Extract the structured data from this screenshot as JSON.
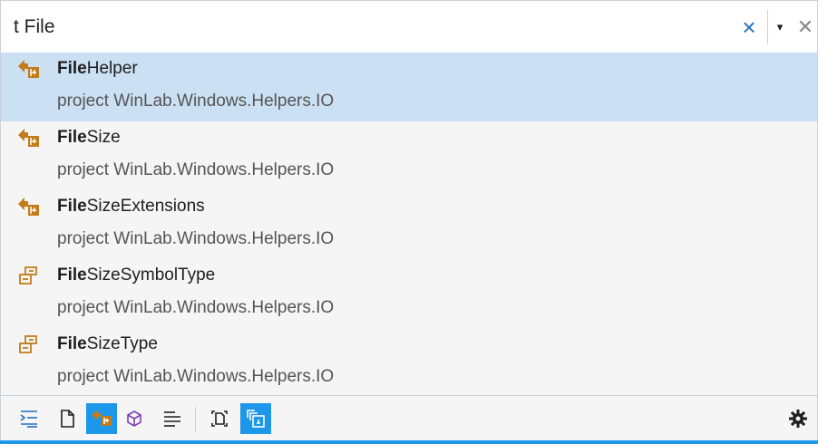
{
  "search": {
    "value": "t File",
    "clear_icon": "×",
    "dropdown_icon": "▾",
    "close_icon": "✕"
  },
  "results": [
    {
      "match": "File",
      "rest": "Helper",
      "location": "project WinLab.Windows.Helpers.IO",
      "icon": "class-extension-icon",
      "selected": true
    },
    {
      "match": "File",
      "rest": "Size",
      "location": "project WinLab.Windows.Helpers.IO",
      "icon": "class-extension-icon",
      "selected": false
    },
    {
      "match": "File",
      "rest": "SizeExtensions",
      "location": "project WinLab.Windows.Helpers.IO",
      "icon": "class-extension-icon",
      "selected": false
    },
    {
      "match": "File",
      "rest": "SizeSymbolType",
      "location": "project WinLab.Windows.Helpers.IO",
      "icon": "enum-icon",
      "selected": false
    },
    {
      "match": "File",
      "rest": "SizeType",
      "location": "project WinLab.Windows.Helpers.IO",
      "icon": "enum-icon",
      "selected": false
    }
  ],
  "toolbar": {
    "filters": [
      {
        "name": "all-filter-icon",
        "active": false
      },
      {
        "name": "file-filter-icon",
        "active": false
      },
      {
        "name": "type-filter-icon",
        "active": true
      },
      {
        "name": "member-filter-icon",
        "active": false
      },
      {
        "name": "text-filter-icon",
        "active": false
      },
      {
        "name": "current-document-icon",
        "active": false
      },
      {
        "name": "external-items-icon",
        "active": true
      }
    ],
    "settings_icon": "gear-icon"
  },
  "colors": {
    "accent": "#1c97ea",
    "selection": "#cce0f4",
    "clear": "#1e6fc4",
    "class_icon": "#c27d1a"
  }
}
